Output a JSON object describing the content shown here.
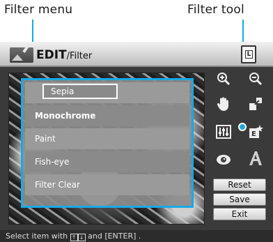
{
  "callouts": {
    "left": "Filter menu",
    "right": "Filter tool"
  },
  "titlebar": {
    "title": "EDIT",
    "separator": "/",
    "subtitle": "Filter",
    "print_icon_label": "L"
  },
  "filter_menu": {
    "items": [
      {
        "label": "Sepia"
      },
      {
        "label": "Monochrome"
      },
      {
        "label": "Paint"
      },
      {
        "label": "Fish-eye"
      },
      {
        "label": "Filter Clear"
      }
    ],
    "selected": "Sepia"
  },
  "tools": [
    {
      "name": "zoom-in-icon"
    },
    {
      "name": "zoom-out-icon"
    },
    {
      "name": "hand-icon"
    },
    {
      "name": "resize-icon"
    },
    {
      "name": "adjust-sliders-icon"
    },
    {
      "name": "filter-effect-icon"
    },
    {
      "name": "red-eye-icon"
    },
    {
      "name": "text-style-icon"
    }
  ],
  "buttons": {
    "reset": "Reset",
    "save": "Save",
    "exit": "Exit"
  },
  "status": {
    "before": "Select item with ",
    "keys": [
      "↑",
      "↓"
    ],
    "after": " and [ENTER] ."
  },
  "colors": {
    "accent": "#19a9e5",
    "screen_bg": "#3a3a3a",
    "menu_bg": "#8a8a8a"
  }
}
